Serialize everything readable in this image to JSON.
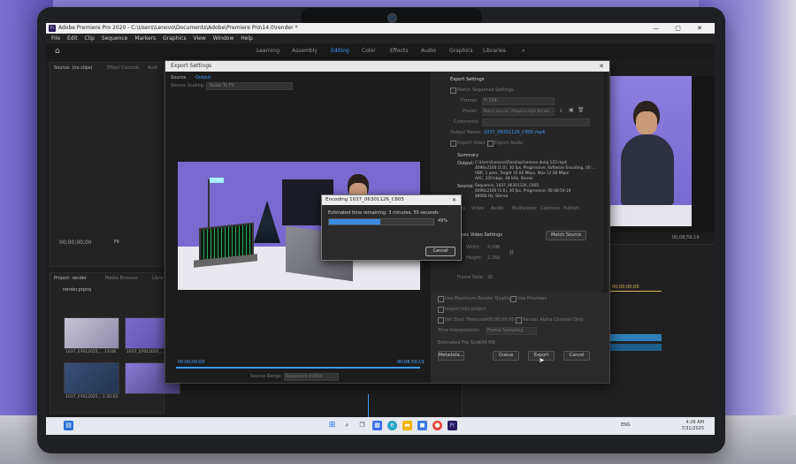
{
  "window": {
    "title": "Adobe Premiere Pro 2020 - C:\\Users\\Lenovo\\Documents\\Adobe\\Premiere Pro\\14.0\\render *",
    "controls": "—  ▢  ✕"
  },
  "menu": [
    "File",
    "Edit",
    "Clip",
    "Sequence",
    "Markers",
    "Graphics",
    "View",
    "Window",
    "Help"
  ],
  "workspaces": {
    "items": [
      "Learning",
      "Assembly",
      "Editing",
      "Color",
      "Effects",
      "Audio",
      "Graphics",
      "Libraries"
    ],
    "active": "Editing",
    "more": "»"
  },
  "source_panel": {
    "tabs": [
      "Source: (no clips)",
      "Effect Controls",
      "Audi"
    ],
    "timecode": "00;00;00;00",
    "fit": "Fit"
  },
  "project_panel": {
    "tabs": [
      "Project: render",
      "Media Browser",
      "Libra"
    ],
    "file": "render.prproj",
    "clips": [
      {
        "name": "1037_07012025_...",
        "duration": "13:08"
      },
      {
        "name": "1037_07012025_...",
        "duration": ""
      },
      {
        "name": "1037_07012025_...",
        "duration": "1:42:02"
      },
      {
        "name": "",
        "duration": ""
      }
    ]
  },
  "export_dialog": {
    "title": "Export Settings",
    "close": "✕",
    "tabs": [
      "Source",
      "Output"
    ],
    "source_scaling_label": "Source Scaling:",
    "source_scaling_value": "Scale To Fit",
    "timecode_left": "00;00;00;00",
    "timecode_right": "00;08;59;19",
    "source_range_label": "Source Range:",
    "source_range_value": "Sequence In/Out",
    "settings_title": "Export Settings",
    "match_sequence": "Match Sequence Settings",
    "format_label": "Format:",
    "format_value": "H.264",
    "preset_label": "Preset:",
    "preset_value": "Match Source - Adaptive High Bitrate",
    "comments_label": "Comments:",
    "output_name_label": "Output Name:",
    "output_name_value": "1037_06301126_C805.mp4",
    "export_video": "Export Video",
    "export_audio": "Export Audio",
    "summary_title": "Summary",
    "output_label": "Output:",
    "output_lines": [
      "C:\\Users\\Lenovo\\Desktop\\Lenovo dung 123.mp4",
      "4096x2160 (1.0), 30 fps, Progressive, Software Encoding, 00:...",
      "VBR, 1 pass, Target 10.00 Mbps, Max 12.00 Mbps",
      "AAC, 320 kbps, 48 kHz, Stereo"
    ],
    "source_label": "Source:",
    "source_lines": [
      "Sequence, 1037_06301126_C805",
      "4096x2160 (1.0), 30 fps, Progressive, 00:08:59:19",
      "48000 Hz, Stereo"
    ],
    "right_tabs": [
      "Effects",
      "Video",
      "Audio",
      "Multiplexer",
      "Captions",
      "Publish"
    ],
    "basic_video_settings": "Basic Video Settings",
    "match_source": "Match Source",
    "width_label": "Width:",
    "width_value": "4,096",
    "height_label": "Height:",
    "height_value": "2,160",
    "frame_rate_label": "Frame Rate:",
    "frame_rate_value": "30",
    "max_render": "Use Maximum Render Quality",
    "use_previews": "Use Previews",
    "import_project": "Import into project",
    "start_timecode": "Set Start Timecode",
    "start_timecode_value": "00;00;00;00",
    "render_alpha": "Render Alpha Channel Only",
    "time_interp_label": "Time Interpolation:",
    "time_interp_value": "Frame Sampling",
    "file_size_label": "Estimated File Size:",
    "file_size_value": "649 MB",
    "metadata_btn": "Metadata...",
    "queue_btn": "Queue",
    "export_btn": "Export",
    "cancel_btn": "Cancel"
  },
  "encoding": {
    "title": "Encoding 1037_06301126_C805",
    "close": "✕",
    "estimate": "Estimated time remaining: 3 minutes, 55 seconds",
    "progress": 0.49,
    "percent": "49%",
    "cancel": "Cancel"
  },
  "program": {
    "timecode": "00;08;59;19",
    "timeline_timecode": "00;00;00;00"
  },
  "taskbar": {
    "time": "4:26 AM",
    "date": "7/31/2025",
    "lang": "ENG",
    "icons": [
      "windows",
      "search",
      "task-view",
      "widgets",
      "edge",
      "explorer",
      "store",
      "chrome",
      "premiere"
    ]
  },
  "colors": {
    "accent": "#3d9cff",
    "progress": "#3d8be0",
    "premiere": "#2a1a5e"
  }
}
